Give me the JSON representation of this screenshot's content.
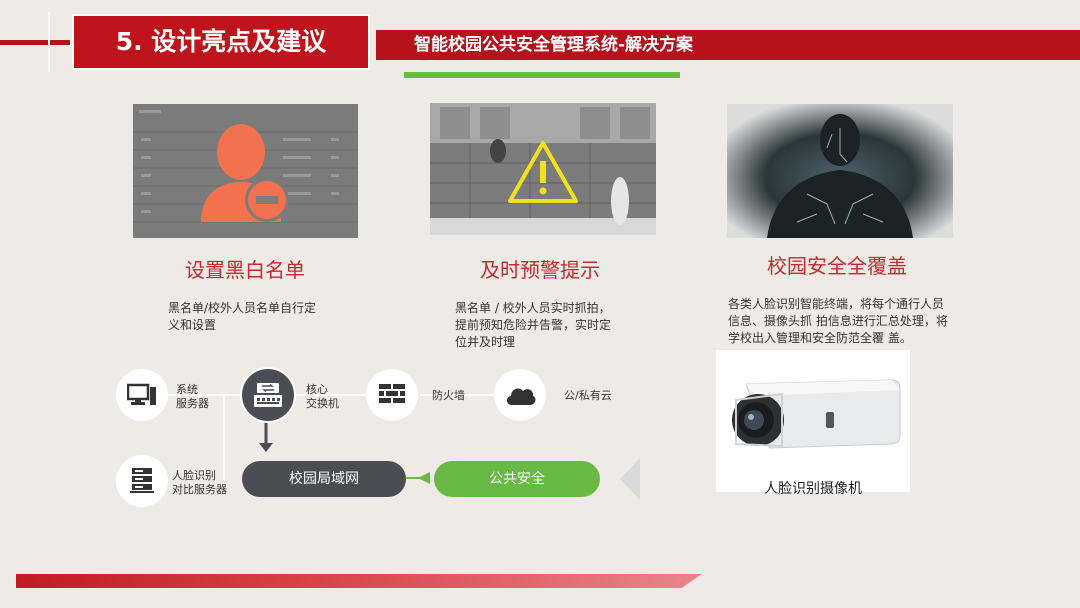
{
  "header": {
    "section_title": "5. 设计亮点及建议",
    "subtitle": "智能校园公共安全管理系统-解决方案"
  },
  "features": [
    {
      "title": "设置黑白名单",
      "desc_lines": [
        "黑名单/校外人员名单自行定",
        "义和设置"
      ]
    },
    {
      "title": "及时预警提示",
      "desc_lines": [
        "黑名单 / 校外人员实时抓拍，",
        "提前预知危险并告警，实时定",
        "位并及时理"
      ]
    },
    {
      "title": "校园安全全覆盖",
      "desc_lines": [
        "各类人脸识别智能终端，将每个通行人员",
        "信息、摄像头抓  拍信息进行汇总处理，将",
        "学校出入管理和安全防范全覆  盖。"
      ]
    }
  ],
  "network": {
    "nodes": [
      {
        "label_lines": [
          "系统",
          "服务器"
        ],
        "icon": "monitor-icon"
      },
      {
        "label_lines": [
          "核心",
          "交换机"
        ],
        "icon": "switch-icon"
      },
      {
        "label_lines": [
          "防火墙"
        ],
        "icon": "firewall-icon"
      },
      {
        "label_lines": [
          "公/私有云"
        ],
        "icon": "cloud-icon"
      },
      {
        "label_lines": [
          "人脸识别",
          "对比服务器"
        ],
        "icon": "server-rack-icon"
      }
    ],
    "lan_label": "校园局域网",
    "public_label": "公共安全"
  },
  "camera": {
    "label": "人脸识别摄像机"
  },
  "colors": {
    "brand_red": "#c0141d",
    "accent_green": "#69ba45",
    "dark_node": "#4b4c54",
    "feature_title": "#c62a31"
  }
}
